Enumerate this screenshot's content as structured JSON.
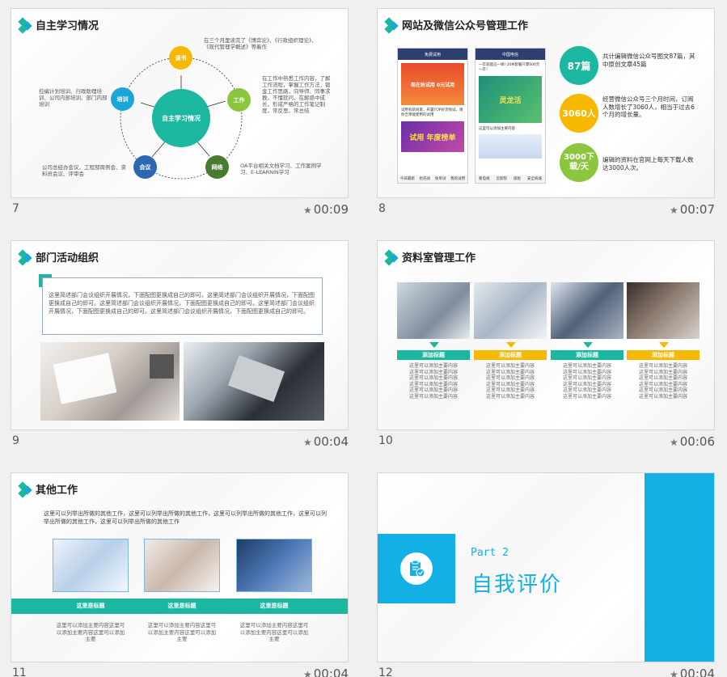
{
  "slides": [
    {
      "number": "7",
      "time": "00:09",
      "title": "自主学习情况",
      "center": "自主学习情况",
      "nodes": [
        "读书",
        "工作",
        "网络",
        "会议",
        "培训"
      ],
      "texts": {
        "reading": "在三个月里读完了《博弈论》、《行政组织理论》、《现代管理学概述》等着作",
        "work": "在工作中熟悉工作内容，了解工作流程，掌握工作方法，锻金工作思路，向导师、同事求教，不懂就问，在解惑中成长，形成严格的工作笔记制度，常反思，常总结",
        "network": "OA平台相关文档学习、工作案例学习、E-LEARNIN学习",
        "meeting": "公司总经办会议、工程部周例会、资料员会议、评审会",
        "training": "控编计划培训、行政助理培训、公司内部培训、部门内部培训"
      }
    },
    {
      "number": "8",
      "time": "00:07",
      "title": "网站及微信公众号管理工作",
      "phone1": {
        "header": "免费试用",
        "ad_top": "现在抢试用 0元试用",
        "body": "试用有新商家，布置TOP好货购试，限你吉帝能使用的试用",
        "banner": "试用 年度榜单",
        "tabs": [
          "今日最新",
          "抢先试",
          "免单试",
          "我的试用"
        ]
      },
      "phone2": {
        "header": "中国电信",
        "line1": "一年就能这一样! 20M套餐只需600元一年！",
        "mag": "灵龙活",
        "line2": "这里可以添加主要内容",
        "tabs": [
          "看电视",
          "云影院",
          "旅程",
          "安全商城"
        ]
      },
      "stats": [
        {
          "value": "87篇",
          "color": "#1bb7a0",
          "text": "共计编辑微信公众号图文87篇，其中原创文章45篇"
        },
        {
          "value": "3060人",
          "color": "#f6b800",
          "text": "经营微信公众号三个月时间，订阅人数增长了3060人，相当于过去6个月的增长量。"
        },
        {
          "value": "3000下载/天",
          "color": "#8cc63f",
          "text": "编辑的资料在官网上每天下载人数达3000人次。"
        }
      ]
    },
    {
      "number": "9",
      "time": "00:04",
      "title": "部门活动组织",
      "body": "这里简述部门会议组织开展情况，下面配图更换成自己的即可。这里简述部门会议组织开展情况，下面配图更换成自己的即可。这里简述部门会议组织开展情况，下面配图更换成自己的即可。这里简述部门会议组织开展情况，下面配图更换成自己的即可。这里简述部门会议组织开展情况，下面配图更换成自己的即可。"
    },
    {
      "number": "10",
      "time": "00:06",
      "title": "资料室管理工作",
      "cards": [
        {
          "label": "添加标题",
          "color": "#1bb7a0",
          "text": "这里可以添加主要内容"
        },
        {
          "label": "添加标题",
          "color": "#f6b800",
          "text": "这里可以添加主要内容"
        },
        {
          "label": "添加标题",
          "color": "#1bb7a0",
          "text": "这里可以添加主要内容"
        },
        {
          "label": "添加标题",
          "color": "#f6b800",
          "text": "这里可以添加主要内容"
        }
      ]
    },
    {
      "number": "11",
      "time": "00:04",
      "title": "其他工作",
      "intro": "这里可以列举出所做的其他工作，这里可以列举出所做的其他工作，这里可以列举出所做的其他工作，这里可以列举出所做的其他工作，这里可以列举出所做的其他工作",
      "items": [
        {
          "label": "这里是标题",
          "text": "这里可以添加主要内容这里可以添加主要内容这里可以添加主要"
        },
        {
          "label": "这里是标题",
          "text": "这里可以添加主要内容这里可以添加主要内容这里可以添加主要"
        },
        {
          "label": "这里是标题",
          "text": "这里可以添加主要内容这里可以添加主要内容这里可以添加主要"
        }
      ]
    },
    {
      "number": "12",
      "time": "00:04",
      "part": "Part 2",
      "title": "自我评价"
    }
  ],
  "colors": {
    "teal": "#1bb7a0",
    "blue": "#1aa6d9",
    "sky": "#13b0e6",
    "yellow": "#f6b800",
    "green": "#8cc63f",
    "darkgreen": "#4a7a2e",
    "navy": "#2a69b0"
  }
}
